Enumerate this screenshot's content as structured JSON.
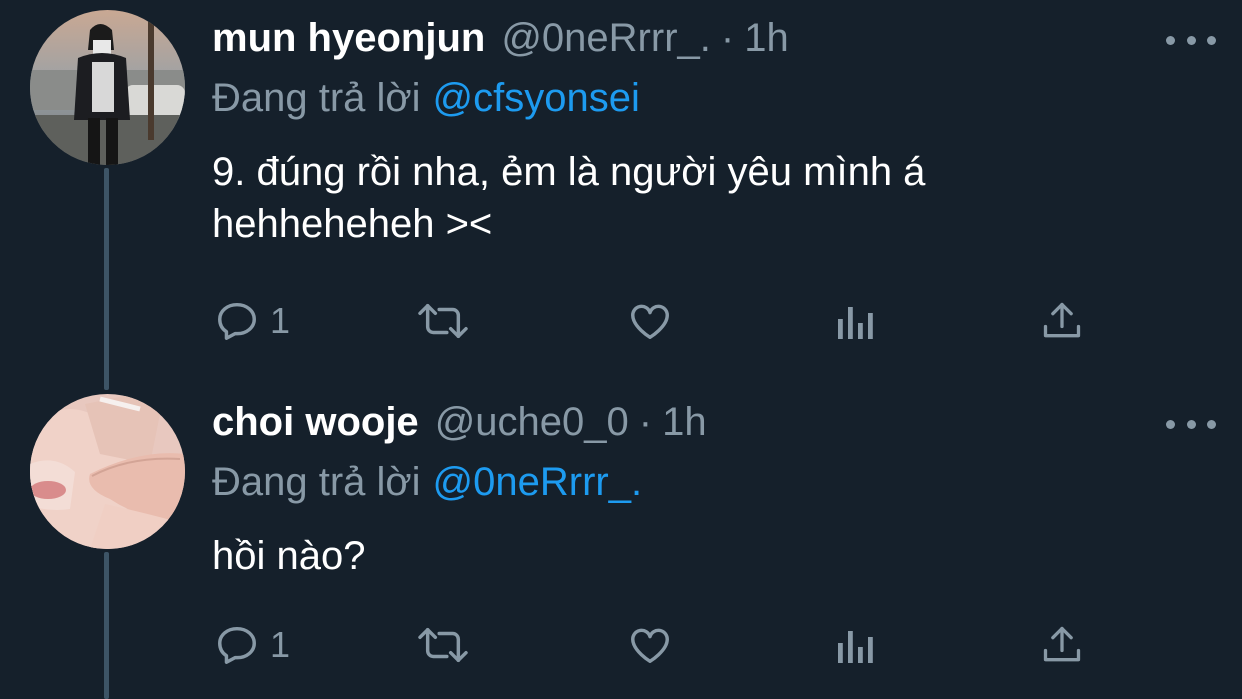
{
  "tweets": [
    {
      "name": "mun hyeonjun",
      "handle": "@0neRrrr_.",
      "separator": "·",
      "time": "1h",
      "reply_prefix": "Đang trả lời",
      "reply_to": "@cfsyonsei",
      "text_lines": [
        "9. đúng rồi nha, ẻm là người yêu mình á",
        "hehheheheh ><"
      ],
      "actions": {
        "reply_count": "1",
        "retweet_count": "",
        "like_count": ""
      }
    },
    {
      "name": "choi wooje",
      "handle": "@uche0_0",
      "separator": "·",
      "time": "1h",
      "reply_prefix": "Đang trả lời",
      "reply_to": "@0neRrrr_.",
      "text_lines": [
        "hồi nào?"
      ],
      "actions": {
        "reply_count": "1",
        "retweet_count": "",
        "like_count": ""
      }
    }
  ],
  "icons": {
    "reply": "reply-icon",
    "retweet": "retweet-icon",
    "like": "heart-icon",
    "analytics": "analytics-icon",
    "share": "share-icon",
    "more": "more-icon"
  },
  "colors": {
    "background": "#15202b",
    "secondary_text": "#8899a6",
    "link": "#1d9bf0",
    "thread_line": "#3d5466"
  }
}
